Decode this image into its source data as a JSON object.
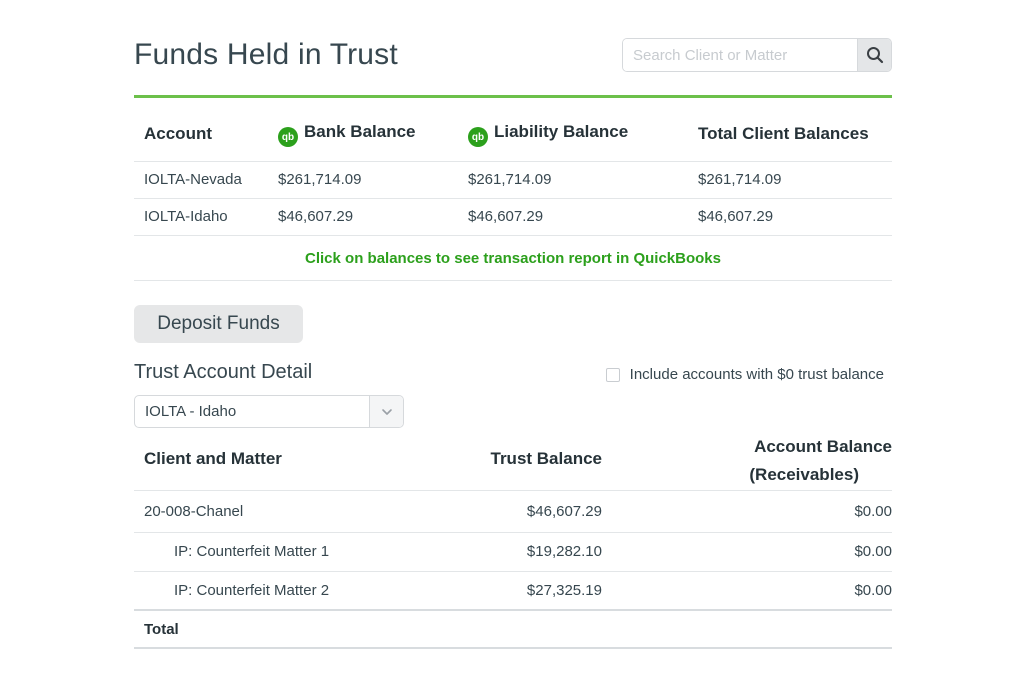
{
  "header": {
    "title": "Funds Held in Trust",
    "search_placeholder": "Search Client or Matter"
  },
  "summary": {
    "columns": {
      "account": "Account",
      "bank_balance": "Bank Balance",
      "liability_balance": "Liability Balance",
      "total_client_balances": "Total Client Balances"
    },
    "qb_icon_text": "qb",
    "rows": [
      {
        "account": "IOLTA-Nevada",
        "bank": "$261,714.09",
        "liability": "$261,714.09",
        "total": "$261,714.09"
      },
      {
        "account": "IOLTA-Idaho",
        "bank": "$46,607.29",
        "liability": "$46,607.29",
        "total": "$46,607.29"
      }
    ],
    "hint": "Click on balances to see transaction report in QuickBooks",
    "accent_color": "#2ca01c"
  },
  "deposit_button": "Deposit Funds",
  "detail": {
    "title": "Trust Account Detail",
    "include_zero_label": "Include accounts with $0 trust balance",
    "include_zero_checked": false,
    "selected_account": "IOLTA - Idaho",
    "columns": {
      "client_matter": "Client and Matter",
      "trust_balance": "Trust Balance",
      "account_balance_line1": "Account Balance",
      "account_balance_line2": "(Receivables)"
    },
    "rows": [
      {
        "name": "20-008-Chanel",
        "trust": "$46,607.29",
        "account": "$0.00"
      },
      {
        "name": "IP: Counterfeit Matter 1",
        "trust": "$19,282.10",
        "account": "$0.00"
      },
      {
        "name": "IP: Counterfeit Matter 2",
        "trust": "$27,325.19",
        "account": "$0.00"
      }
    ],
    "total_label": "Total"
  }
}
